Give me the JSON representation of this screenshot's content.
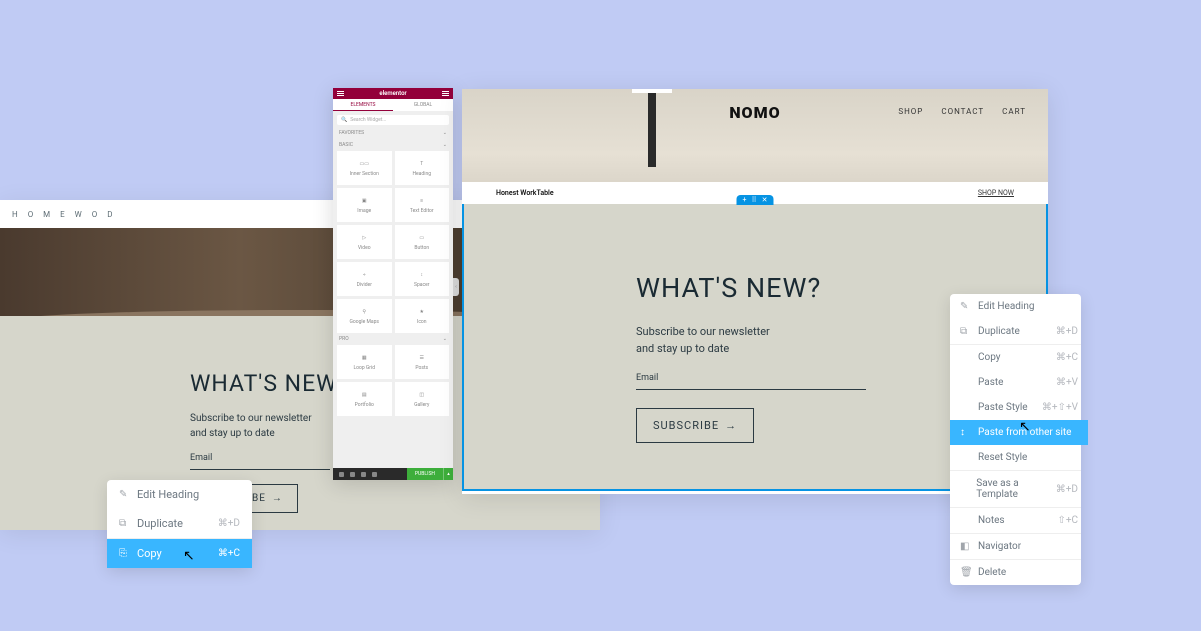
{
  "leftSite": {
    "logo": "H O M E W O D",
    "newsletter": {
      "title": "WHAT'S NEW?",
      "line1": "Subscribe to our newsletter",
      "line2": "and stay up to date",
      "emailLabel": "Email",
      "button": "SUBSCRIBE"
    }
  },
  "leftMenu": {
    "editHeading": "Edit Heading",
    "duplicate": "Duplicate",
    "duplicateKey": "⌘+D",
    "copy": "Copy",
    "copyKey": "⌘+C"
  },
  "panel": {
    "brand": "elementor",
    "tabElements": "ELEMENTS",
    "tabGlobal": "GLOBAL",
    "searchPlaceholder": "Search Widget...",
    "catFavorites": "FAVORITES",
    "catBasic": "BASIC",
    "catPro": "PRO",
    "publish": "PUBLISH",
    "widgets": {
      "innerSection": "Inner Section",
      "heading": "Heading",
      "image": "Image",
      "textEditor": "Text Editor",
      "video": "Video",
      "button": "Button",
      "divider": "Divider",
      "spacer": "Spacer",
      "googleMaps": "Google Maps",
      "icon": "Icon",
      "loopGrid": "Loop Grid",
      "posts": "Posts",
      "portfolio": "Portfolio",
      "gallery": "Gallery"
    }
  },
  "rightSite": {
    "logo": "NOMO",
    "nav": {
      "shop": "SHOP",
      "contact": "CONTACT",
      "cart": "CART"
    },
    "productName": "Honest WorkTable",
    "shopNow": "SHOP NOW",
    "newsletter": {
      "title": "WHAT'S NEW?",
      "line1": "Subscribe to our newsletter",
      "line2": "and stay up to date",
      "emailLabel": "Email",
      "button": "SUBSCRIBE"
    }
  },
  "rightMenu": {
    "editHeading": "Edit Heading",
    "duplicate": "Duplicate",
    "duplicateKey": "⌘+D",
    "copy": "Copy",
    "copyKey": "⌘+C",
    "paste": "Paste",
    "pasteKey": "⌘+V",
    "pasteStyle": "Paste Style",
    "pasteStyleKey": "⌘+⇧+V",
    "pasteFromOther": "Paste from other site",
    "resetStyle": "Reset Style",
    "saveTemplate": "Save as a Template",
    "saveKey": "⌘+D",
    "notes": "Notes",
    "notesKey": "⇧+C",
    "navigator": "Navigator",
    "delete": "Delete"
  }
}
